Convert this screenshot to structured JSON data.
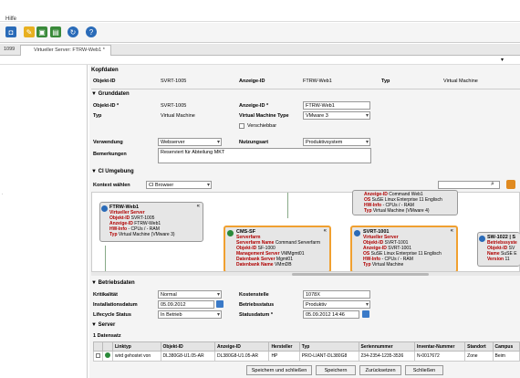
{
  "menu": {
    "help": "Hilfe"
  },
  "tabs": [
    {
      "label": "1099"
    },
    {
      "label": "Virtueller Server: FTRW-Web1 *"
    }
  ],
  "kopfdaten": {
    "title": "Kopfdaten",
    "objekt_id_label": "Objekt-ID",
    "objekt_id": "SVRT-1005",
    "anzeige_id_label": "Anzeige-ID",
    "anzeige_id": "FTRW-Web1",
    "typ_label": "Typ",
    "typ": "Virtual Machine"
  },
  "grunddaten": {
    "title": "Grunddaten",
    "objekt_id_label": "Objekt-ID *",
    "objekt_id": "SVRT-1005",
    "anzeige_id_label": "Anzeige-ID *",
    "anzeige_id": "FTRW-Web1",
    "typ_label": "Typ",
    "typ": "Virtual Machine",
    "vm_type_label": "Virtual Machine Type",
    "vm_type": "VMware 3",
    "verschiebbar_label": "Verschiebbar",
    "verwendung_label": "Verwendung",
    "verwendung": "Webserver",
    "nutzungsart_label": "Nutzungsart",
    "nutzungsart": "Produktivsystem",
    "bemerkungen_label": "Bemerkungen",
    "bemerkungen": "Reserviert für Abteilung MKT"
  },
  "ci_umgebung": {
    "title": "CI Umgebung",
    "kontext_label": "Kontext wählen",
    "kontext": "CI Browser",
    "cards": [
      {
        "title": "FTRW-Web1",
        "lines": [
          [
            "",
            "Virtueller Server"
          ],
          [
            "Objekt-ID",
            "SVRT-1005"
          ],
          [
            "Anzeige-ID",
            "FTRW-Web1"
          ],
          [
            "HW-Info",
            "- CPUs / - RAM"
          ],
          [
            "Typ",
            "Virtual Machine (VMware 3)"
          ]
        ]
      },
      {
        "title": "CMS-SF",
        "lines": [
          [
            "",
            "Serverfarm"
          ],
          [
            "Serverfarm Name",
            "Command Serverfarm"
          ],
          [
            "Objekt-ID",
            "SF-1000"
          ],
          [
            "Management Server",
            "VMMgmt01"
          ],
          [
            "Datenbank Server",
            "Mgmt01"
          ],
          [
            "Datenbank Name",
            "VMmDB"
          ]
        ]
      },
      {
        "title": "",
        "lines": [
          [
            "Anzeige-ID",
            "Command Web1"
          ],
          [
            "OS",
            "SuSE Linux Enterprise 11 Englisch"
          ],
          [
            "HW-Info",
            "- CPUs / - RAM"
          ],
          [
            "Typ",
            "Virtual Machine (VMware 4)"
          ]
        ]
      },
      {
        "title": "SVRT-1001",
        "lines": [
          [
            "",
            "Virtueller Server"
          ],
          [
            "Objekt-ID",
            "SVRT-1001"
          ],
          [
            "Anzeige-ID",
            "SVRT-1001"
          ],
          [
            "OS",
            "SuSE Linux Enterprise 11 Englisch"
          ],
          [
            "HW-Info",
            "- CPUs / - RAM"
          ],
          [
            "Typ",
            "Virtual Machine"
          ]
        ]
      },
      {
        "title": "SW-1022 | S",
        "lines": [
          [
            "",
            "Betriebssyste"
          ],
          [
            "Objekt-ID",
            "SV"
          ],
          [
            "Name",
            "SuSE E"
          ],
          [
            "Version",
            "11"
          ]
        ]
      }
    ]
  },
  "betriebsdaten": {
    "title": "Betriebsdaten",
    "kritikalitaet_label": "Kritikalität",
    "kritikalitaet": "Normal",
    "kostenstelle_label": "Kostenstelle",
    "kostenstelle": "1078X",
    "installationsdatum_label": "Installationsdatum",
    "installationsdatum": "05.09.2012",
    "betriebsstatus_label": "Betriebsstatus",
    "betriebsstatus": "Produktiv",
    "lifecycle_label": "Lifecycle Status",
    "lifecycle": "In Betrieb",
    "statusdatum_label": "Statusdatum *",
    "statusdatum": "05.09.2012 14:46"
  },
  "server": {
    "title": "Server",
    "count": "1 Datensatz",
    "columns": [
      "Linktyp",
      "Objekt-ID",
      "Anzeige-ID",
      "Hersteller",
      "Typ",
      "Seriennummer",
      "Inventar-Nummer",
      "Standort",
      "Campus"
    ],
    "rows": [
      [
        "wird gehostet von",
        "DL380G8-U1.05-AR",
        "DL380G8-U1.05-AR",
        "HP",
        "PRO-LIANT-DL380G8",
        "234-2354-1235-3536",
        "N-0017672",
        "Zone",
        "Beim"
      ]
    ]
  },
  "buttons": {
    "save_close": "Speichern und schließen",
    "save": "Speichern",
    "reset": "Zurücksetzen",
    "close": "Schließen"
  },
  "colors": {
    "red_label": "#c00000",
    "orange_border": "#f0a030"
  }
}
